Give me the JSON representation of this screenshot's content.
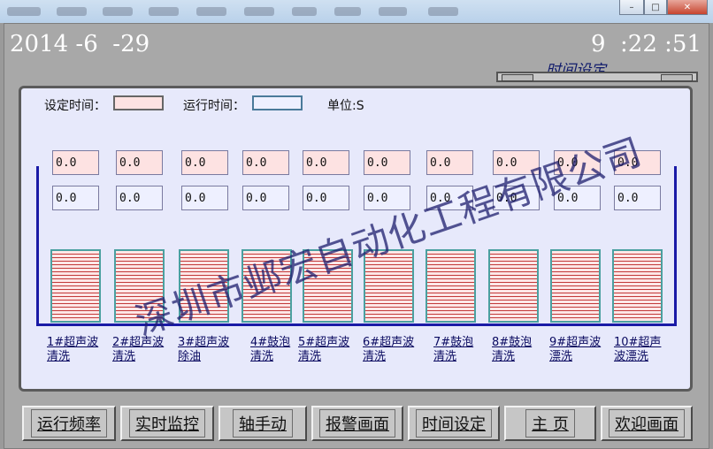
{
  "header": {
    "date": "2014 -6  -29",
    "time": "9  :22 :51",
    "screen_title": "时间设定"
  },
  "legend": {
    "set_time_label": "设定时间：",
    "run_time_label": "运行时间：",
    "unit_label": "单位:S"
  },
  "stations": [
    {
      "set": "0.0",
      "run": "0.0",
      "label_line1": "1#超声波",
      "label_line2": "清洗"
    },
    {
      "set": "0.0",
      "run": "0.0",
      "label_line1": "2#超声波",
      "label_line2": "清洗"
    },
    {
      "set": "0.0",
      "run": "0.0",
      "label_line1": "3#超声波",
      "label_line2": "除油"
    },
    {
      "set": "0.0",
      "run": "0.0",
      "label_line1": "4#鼓泡",
      "label_line2": "清洗"
    },
    {
      "set": "0.0",
      "run": "0.0",
      "label_line1": "5#超声波",
      "label_line2": "清洗"
    },
    {
      "set": "0.0",
      "run": "0.0",
      "label_line1": "6#超声波",
      "label_line2": "清洗"
    },
    {
      "set": "0.0",
      "run": "0.0",
      "label_line1": "7#鼓泡",
      "label_line2": "清洗"
    },
    {
      "set": "0.0",
      "run": "0.0",
      "label_line1": "8#鼓泡",
      "label_line2": "清洗"
    },
    {
      "set": "0.0",
      "run": "0.0",
      "label_line1": "9#超声波",
      "label_line2": "漂洗"
    },
    {
      "set": "0.0",
      "run": "0.0",
      "label_line1": "10#超声",
      "label_line2": "波漂洗"
    }
  ],
  "watermark": "深圳市邺宏自动化工程有限公司",
  "nav": [
    "运行频率",
    "实时监控",
    "轴手动",
    "报警画面",
    "时间设定",
    "主 页",
    "欢迎画面"
  ],
  "colors": {
    "panel_bg": "#e7e9fb",
    "set_box": "#fde2e2",
    "tank_stripe": "#c23a3a",
    "conveyor": "#1a1aa6"
  }
}
